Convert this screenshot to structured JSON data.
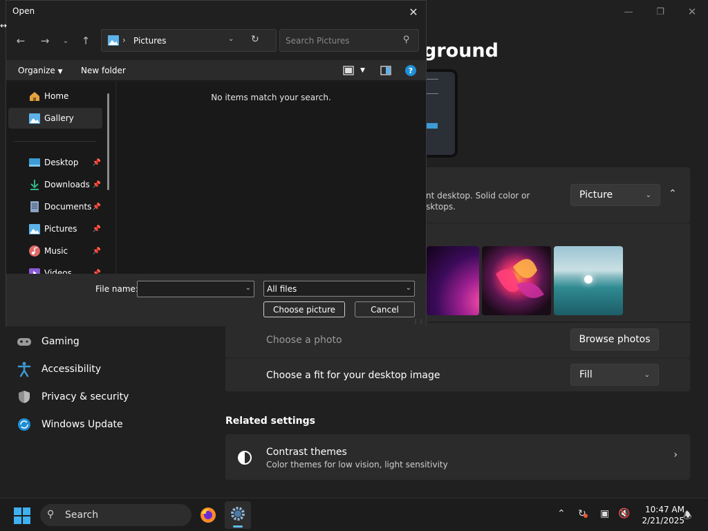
{
  "settings": {
    "page_title": "ground",
    "background_desc_line1": "nt desktop. Solid color or",
    "background_desc_line2": "sktops.",
    "background_type": "Picture",
    "choose_photo_label": "Choose a photo",
    "browse_photos": "Browse photos",
    "fit_label": "Choose a fit for your desktop image",
    "fit_value": "Fill",
    "related_settings": "Related settings",
    "contrast_title": "Contrast themes",
    "contrast_sub": "Color themes for low vision, light sensitivity",
    "nav": [
      {
        "label": "Gaming"
      },
      {
        "label": "Accessibility"
      },
      {
        "label": "Privacy & security"
      },
      {
        "label": "Windows Update"
      }
    ]
  },
  "dialog": {
    "title": "Open",
    "address": "Pictures",
    "search_placeholder": "Search Pictures",
    "organize": "Organize",
    "new_folder": "New folder",
    "empty_message": "No items match your search.",
    "nav_items": [
      {
        "label": "Home"
      },
      {
        "label": "Gallery"
      },
      {
        "label": "Desktop"
      },
      {
        "label": "Downloads"
      },
      {
        "label": "Documents"
      },
      {
        "label": "Pictures"
      },
      {
        "label": "Music"
      },
      {
        "label": "Videos"
      }
    ],
    "file_name_label": "File name:",
    "file_name_value": "",
    "filter": "All files",
    "choose_button": "Choose picture",
    "cancel_button": "Cancel"
  },
  "taskbar": {
    "search_label": "Search",
    "time": "10:47 AM",
    "date": "2/21/2025"
  },
  "colors": {
    "accent": "#3d9bd6",
    "background": "#202020",
    "card": "#2b2b2b"
  }
}
